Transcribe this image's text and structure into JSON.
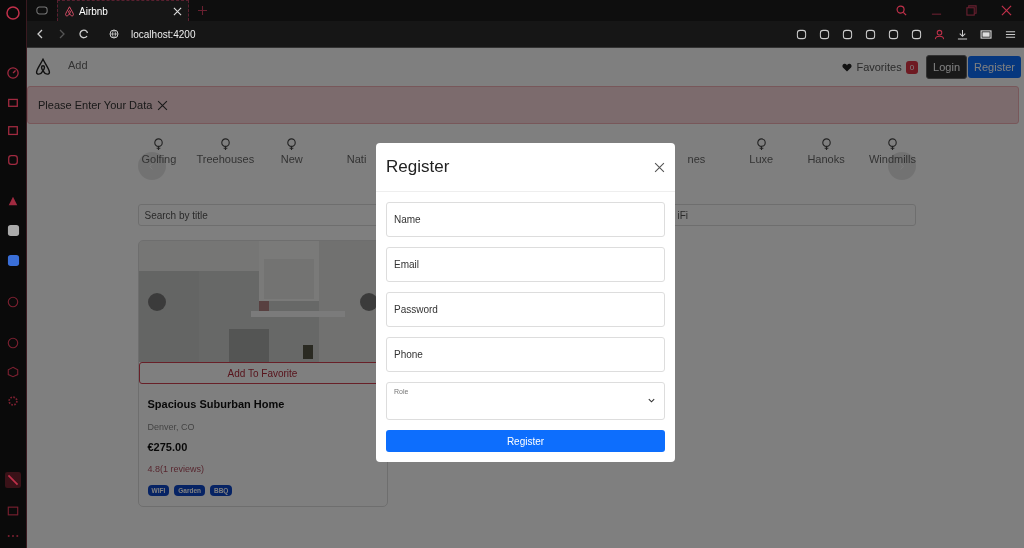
{
  "browser": {
    "tabs": [
      {
        "label": "Airbnb",
        "selected": true
      }
    ],
    "address": "localhost:4200"
  },
  "navbar": {
    "link": "Add",
    "favorites": "Favorites",
    "favorites_count": "0",
    "buttons": [
      {
        "label": "Login",
        "kind": "dark"
      },
      {
        "label": "Register",
        "kind": "primary"
      }
    ]
  },
  "alert": {
    "message": "Please Enter Your Data"
  },
  "categories": [
    {
      "label": "Golfing"
    },
    {
      "label": "Treehouses"
    },
    {
      "label": "New"
    },
    {
      "label": "Nati"
    },
    {
      "label": "nes"
    },
    {
      "label": "Luxe"
    },
    {
      "label": "Hanoks"
    },
    {
      "label": "Windmills"
    }
  ],
  "search": [
    {
      "placeholder": "Search by title"
    },
    {
      "placeholder": "iFi"
    }
  ],
  "listing": {
    "favorite_button": "Add To Favorite",
    "title": "Spacious Suburban Home",
    "location": "Denver, CO",
    "price": "€275.00",
    "rating": "4.8(1 reviews)",
    "tags": [
      "WIFI",
      "Garden",
      "BBQ"
    ]
  },
  "modal": {
    "title": "Register",
    "fields": [
      {
        "kind": "text",
        "placeholder": "Name"
      },
      {
        "kind": "text",
        "placeholder": "Email"
      },
      {
        "kind": "text",
        "placeholder": "Password"
      },
      {
        "kind": "text",
        "placeholder": "Phone"
      },
      {
        "kind": "select",
        "label": "Role"
      }
    ],
    "submit": "Register"
  }
}
